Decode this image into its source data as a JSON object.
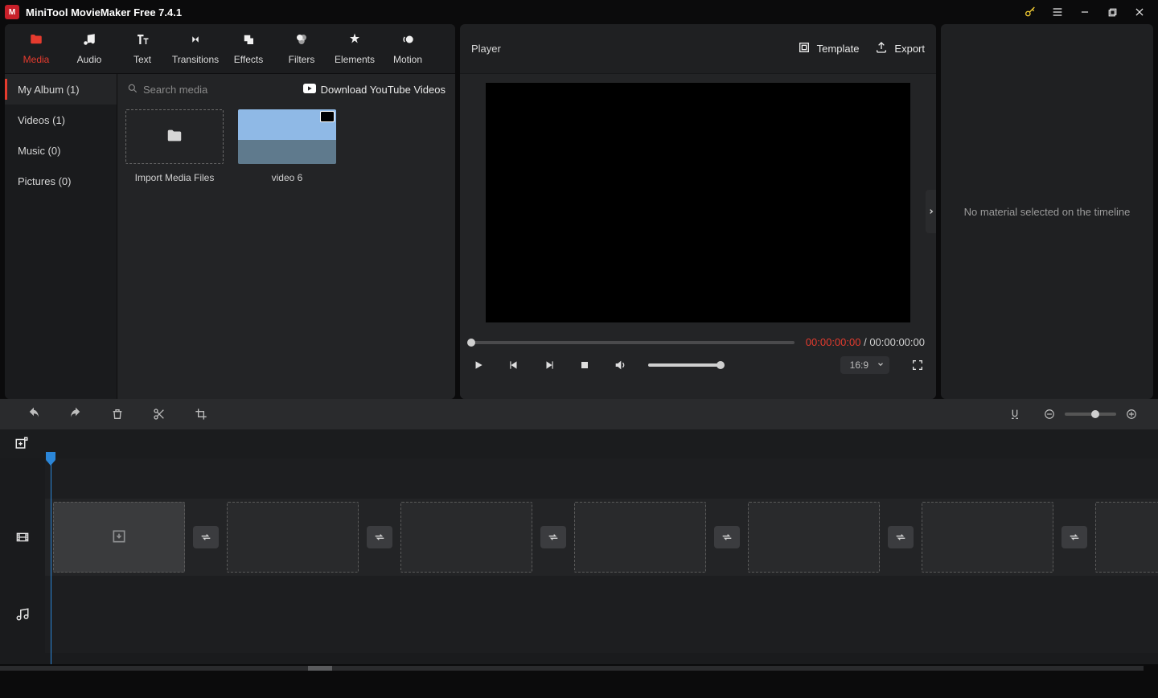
{
  "titlebar": {
    "title": "MiniTool MovieMaker Free 7.4.1"
  },
  "topnav": {
    "items": [
      {
        "label": "Media"
      },
      {
        "label": "Audio"
      },
      {
        "label": "Text"
      },
      {
        "label": "Transitions"
      },
      {
        "label": "Effects"
      },
      {
        "label": "Filters"
      },
      {
        "label": "Elements"
      },
      {
        "label": "Motion"
      }
    ]
  },
  "sidebar": {
    "items": [
      {
        "label": "My Album (1)"
      },
      {
        "label": "Videos (1)"
      },
      {
        "label": "Music (0)"
      },
      {
        "label": "Pictures (0)"
      }
    ]
  },
  "media": {
    "search_placeholder": "Search media",
    "yt_label": "Download YouTube Videos",
    "import_label": "Import Media Files",
    "items": [
      {
        "label": "video 6"
      }
    ]
  },
  "player": {
    "label": "Player",
    "template_label": "Template",
    "export_label": "Export",
    "current_time": "00:00:00:00",
    "separator": " / ",
    "total_time": "00:00:00:00",
    "aspect": "16:9"
  },
  "properties": {
    "empty_msg": "No material selected on the timeline"
  }
}
